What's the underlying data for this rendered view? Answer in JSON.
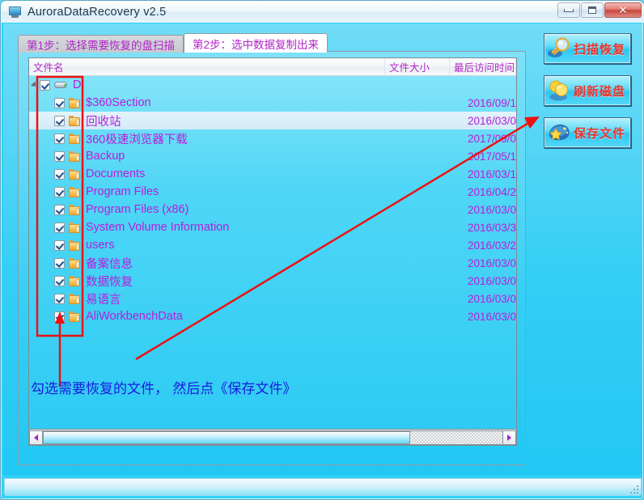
{
  "window": {
    "title": "AuroraDataRecovery v2.5",
    "icon": "app-monitor-icon",
    "controls": {
      "minimize": "─",
      "maximize": "□",
      "close": "✕"
    }
  },
  "tabs": [
    {
      "label": "第1步：选择需要恢复的盘扫描",
      "active": false
    },
    {
      "label": "第2步：选中数据复制出来",
      "active": true
    }
  ],
  "columns": [
    {
      "key": "name",
      "label": "文件名"
    },
    {
      "key": "size",
      "label": "文件大小"
    },
    {
      "key": "time",
      "label": "最后访问时间"
    }
  ],
  "tree": {
    "root": {
      "label": "D:",
      "icon": "drive-icon",
      "checked": true,
      "expanded": true,
      "size": "",
      "time": ""
    },
    "items": [
      {
        "label": "$360Section",
        "icon": "folder-icon",
        "checked": true,
        "size": "",
        "time": "2016/09/1"
      },
      {
        "label": "回收站",
        "icon": "folder-icon",
        "checked": true,
        "size": "",
        "time": "2016/03/0",
        "selected": true
      },
      {
        "label": "360极速浏览器下载",
        "icon": "folder-icon",
        "checked": true,
        "size": "",
        "time": "2017/09/0"
      },
      {
        "label": "Backup",
        "icon": "folder-icon",
        "checked": true,
        "size": "",
        "time": "2017/05/1"
      },
      {
        "label": "Documents",
        "icon": "folder-icon",
        "checked": true,
        "size": "",
        "time": "2016/03/1"
      },
      {
        "label": "Program Files",
        "icon": "folder-icon",
        "checked": true,
        "size": "",
        "time": "2016/04/2"
      },
      {
        "label": "Program Files (x86)",
        "icon": "folder-icon",
        "checked": true,
        "size": "",
        "time": "2016/03/0"
      },
      {
        "label": "System Volume Information",
        "icon": "folder-icon",
        "checked": true,
        "size": "",
        "time": "2016/03/3"
      },
      {
        "label": "users",
        "icon": "folder-icon",
        "checked": true,
        "size": "",
        "time": "2016/03/2"
      },
      {
        "label": "备案信息",
        "icon": "folder-icon",
        "checked": true,
        "size": "",
        "time": "2016/03/0"
      },
      {
        "label": "数据恢复",
        "icon": "folder-icon",
        "checked": true,
        "size": "",
        "time": "2016/03/0"
      },
      {
        "label": "易语言",
        "icon": "folder-icon",
        "checked": true,
        "size": "",
        "time": "2016/03/0"
      },
      {
        "label": "AliWorkbenchData",
        "icon": "folder-icon",
        "checked": true,
        "size": "",
        "time": "2016/03/0"
      }
    ]
  },
  "scrollbar": {
    "left_arrow": "◀",
    "right_arrow": "▶",
    "thumb_percent": 80
  },
  "side_buttons": [
    {
      "label": "扫描恢复",
      "icon": "magnifier-icon"
    },
    {
      "label": "刷新磁盘",
      "icon": "refresh-disk-icon"
    },
    {
      "label": "保存文件",
      "icon": "save-star-icon"
    }
  ],
  "annotation": {
    "text": "勾选需要恢复的文件， 然后点《保存文件》",
    "color": "#1a1ae0",
    "marker_color": "#ee1111"
  },
  "colors": {
    "accent_cyan": "#2ec7f3",
    "item_text": "#b81ddb",
    "button_text": "#e8342a",
    "tab_text": "#b224c8"
  }
}
